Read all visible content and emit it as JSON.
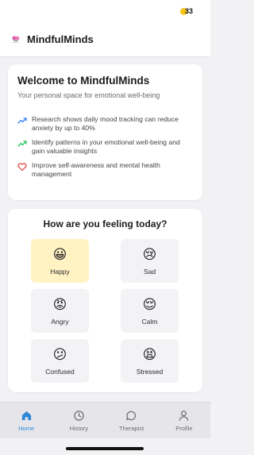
{
  "status_bar": {
    "battery": "33"
  },
  "header": {
    "title": "MindfulMinds"
  },
  "welcome": {
    "title": "Welcome to MindfulMinds",
    "subtitle": "Your personal space for emotional well-being",
    "benefits": [
      {
        "icon": "trend-up-icon",
        "text": "Research shows daily mood tracking can reduce anxiety by up to 40%"
      },
      {
        "icon": "trend-up-green-icon",
        "text": "Identify patterns in your emotional well-being and gain valuable insights"
      },
      {
        "icon": "heart-icon",
        "text": "Improve self-awareness and mental health management"
      }
    ]
  },
  "mood": {
    "title": "How are you feeling today?",
    "selected": "Happy",
    "options": [
      {
        "emoji": "😀",
        "label": "Happy"
      },
      {
        "emoji": "😢",
        "label": "Sad"
      },
      {
        "emoji": "😡",
        "label": "Angry"
      },
      {
        "emoji": "😌",
        "label": "Calm"
      },
      {
        "emoji": "😕",
        "label": "Confused"
      },
      {
        "emoji": "😫",
        "label": "Stressed"
      }
    ]
  },
  "tabs": [
    {
      "label": "Home",
      "icon": "home-icon",
      "active": true
    },
    {
      "label": "History",
      "icon": "clock-icon",
      "active": false
    },
    {
      "label": "Therapist",
      "icon": "chat-bubble-icon",
      "active": false
    },
    {
      "label": "Profile",
      "icon": "user-icon",
      "active": false
    }
  ],
  "colors": {
    "accent": "#2f86d6",
    "selected_mood_bg": "#fff3c4",
    "trend_blue": "#3b82f6",
    "trend_green": "#22c55e",
    "heart_red": "#e23b3b"
  }
}
